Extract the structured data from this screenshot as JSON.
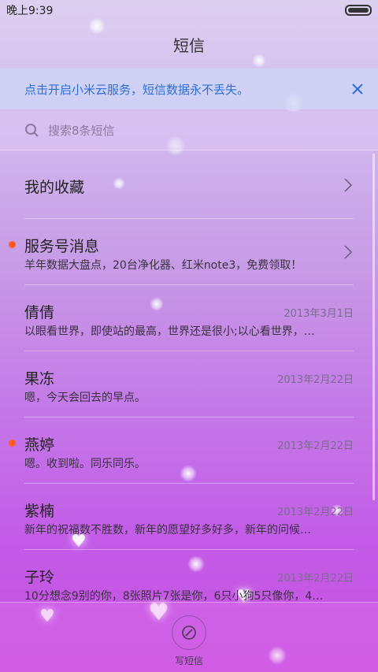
{
  "status": {
    "time": "晚上9:39"
  },
  "title": "短信",
  "banner": {
    "text": "点击开启小米云服务，短信数据永不丢失。",
    "close_icon": "close-icon",
    "color": "#2e6ed6"
  },
  "search": {
    "placeholder": "搜索8条短信"
  },
  "favorites": {
    "label": "我的收藏"
  },
  "conversations": [
    {
      "name": "服务号消息",
      "date": "",
      "preview": "羊年数据大盘点，20台净化器、红米note3，免费领取！",
      "unread": true,
      "chevron": true
    },
    {
      "name": "倩倩",
      "date": "2013年3月1日",
      "preview": "以眼看世界，即使站的最高，世界还是很小;以心看世界，…",
      "unread": false,
      "chevron": false
    },
    {
      "name": "果冻",
      "date": "2013年2月22日",
      "preview": "嗯，今天会回去的早点。",
      "unread": false,
      "chevron": false
    },
    {
      "name": "燕婷",
      "date": "2013年2月22日",
      "preview": "嗯。收到啦。同乐同乐。",
      "unread": true,
      "chevron": false
    },
    {
      "name": "紫楠",
      "date": "2013年2月22日",
      "preview": "新年的祝福数不胜数，新年的愿望好多好多，新年的问候…",
      "unread": false,
      "chevron": false
    },
    {
      "name": "子玲",
      "date": "2013年2月22日",
      "preview": "10分想念9别的你，8张照片7张是你，6只小狗5只像你，4…",
      "unread": false,
      "chevron": false
    }
  ],
  "compose": {
    "label": "写短信",
    "icon": "compose-icon"
  },
  "colors": {
    "unread_dot": "#ff5a1f",
    "date_text": "#7d6a90"
  }
}
